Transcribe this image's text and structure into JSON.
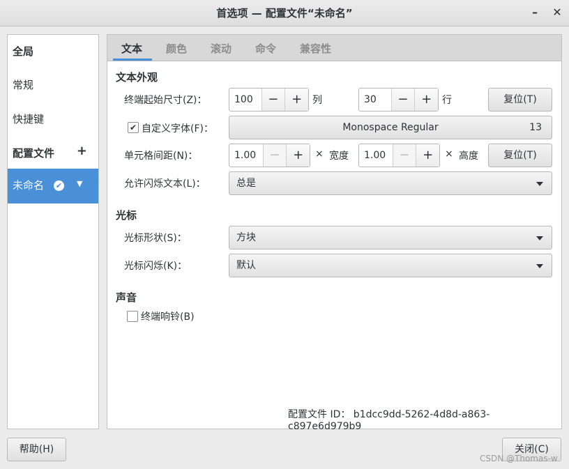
{
  "window": {
    "title": "首选项 — 配置文件“未命名”",
    "minimize": "–",
    "close": "✕"
  },
  "sidebar": {
    "global": "全局",
    "general": "常规",
    "shortcuts": "快捷键",
    "profiles": "配置文件",
    "add": "+",
    "selected_profile": "未命名",
    "selected_check": "✔",
    "selected_dropdown": "▼"
  },
  "tabs": [
    "文本",
    "颜色",
    "滚动",
    "命令",
    "兼容性"
  ],
  "text_appearance": {
    "section": "文本外观",
    "initial_size_label": "终端起始尺寸(Z)：",
    "columns_value": "100",
    "columns_unit": "列",
    "rows_value": "30",
    "rows_unit": "行",
    "reset1": "复位(T)",
    "custom_font_label": "自定义字体(F)：",
    "custom_font_checked": "✔",
    "font_name": "Monospace Regular",
    "font_size": "13",
    "cell_spacing_label": "单元格间距(N)：",
    "width_value": "1.00",
    "width_x": "×",
    "width_unit": "宽度",
    "height_value": "1.00",
    "height_x": "×",
    "height_unit": "高度",
    "reset2": "复位(T)",
    "blink_label": "允许闪烁文本(L)：",
    "blink_value": "总是"
  },
  "cursor": {
    "section": "光标",
    "shape_label": "光标形状(S)：",
    "shape_value": "方块",
    "blink_label": "光标闪烁(K)：",
    "blink_value": "默认"
  },
  "sound": {
    "section": "声音",
    "bell_label": "终端响铃(B)"
  },
  "spin": {
    "minus": "−",
    "plus": "+"
  },
  "profile_id": "配置文件 ID： b1dcc9dd-5262-4d8d-a863-c897e6d979b9",
  "footer": {
    "help": "帮助(H)",
    "close": "关闭(C)"
  },
  "watermark": "CSDN @Thomas-w"
}
